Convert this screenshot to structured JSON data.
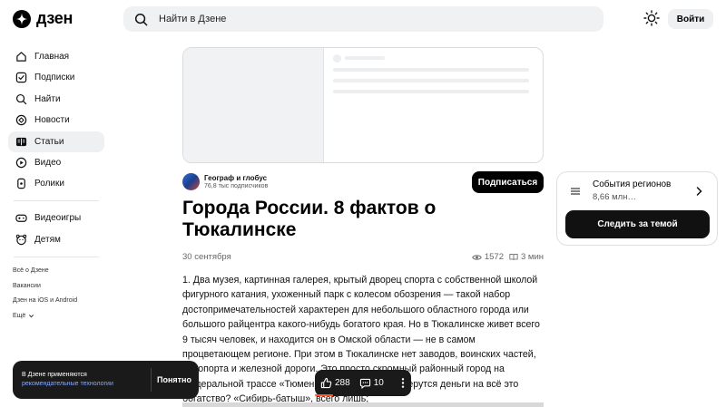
{
  "header": {
    "logo_text": "дзен",
    "search_placeholder": "Найти в Дзене",
    "login_label": "Войти"
  },
  "sidebar": {
    "items": [
      {
        "label": "Главная",
        "icon": "home-icon"
      },
      {
        "label": "Подписки",
        "icon": "subscriptions-icon"
      },
      {
        "label": "Найти",
        "icon": "search-icon"
      },
      {
        "label": "Новости",
        "icon": "news-icon"
      },
      {
        "label": "Статьи",
        "icon": "articles-icon",
        "active": true
      },
      {
        "label": "Видео",
        "icon": "video-icon"
      },
      {
        "label": "Ролики",
        "icon": "shorts-icon"
      }
    ],
    "items2": [
      {
        "label": "Видеоигры",
        "icon": "gamepad-icon"
      },
      {
        "label": "Детям",
        "icon": "kids-icon"
      }
    ],
    "footer": [
      "Всё о Дзене",
      "Вакансии",
      "Дзен на iOS и Android",
      "Ещё"
    ]
  },
  "article": {
    "channel_name": "Географ и глобус",
    "channel_subs": "76,8 тыс подписчиков",
    "subscribe_label": "Подписаться",
    "title": "Города России. 8 фактов о Тюкалинске",
    "date": "30 сентября",
    "views": "1572",
    "read_time": "3 мин",
    "body": "1. Два музея, картинная галерея, крытый дворец спорта с собственной школой фигурного катания, ухоженный парк с колесом обозрения — такой набор достопримечательностей характерен для небольшого областного города или большого райцентра какого-нибудь богатого края. Но в Тюкалинске живет всего 9 тысяч человек, и находится он в Омской области — не в самом процветающем регионе. При этом в Тюкалинске нет заводов, воинских частей, аэропорта и железной дороги. Это просто скромный районный город на федеральной трассе «Тюмень — Омск». Откуда берутся деньги на всё это богатство? «Сибирь-батыш», всего лишь;"
  },
  "widget": {
    "title": "События регионов",
    "subtitle": "8,66 млн…",
    "button_label": "Следить за темой"
  },
  "cookie": {
    "text": "В Дзене применяются",
    "link": "рекомендательные технологии",
    "button_label": "Понятно"
  },
  "actions": {
    "likes": "288",
    "comments": "10"
  }
}
